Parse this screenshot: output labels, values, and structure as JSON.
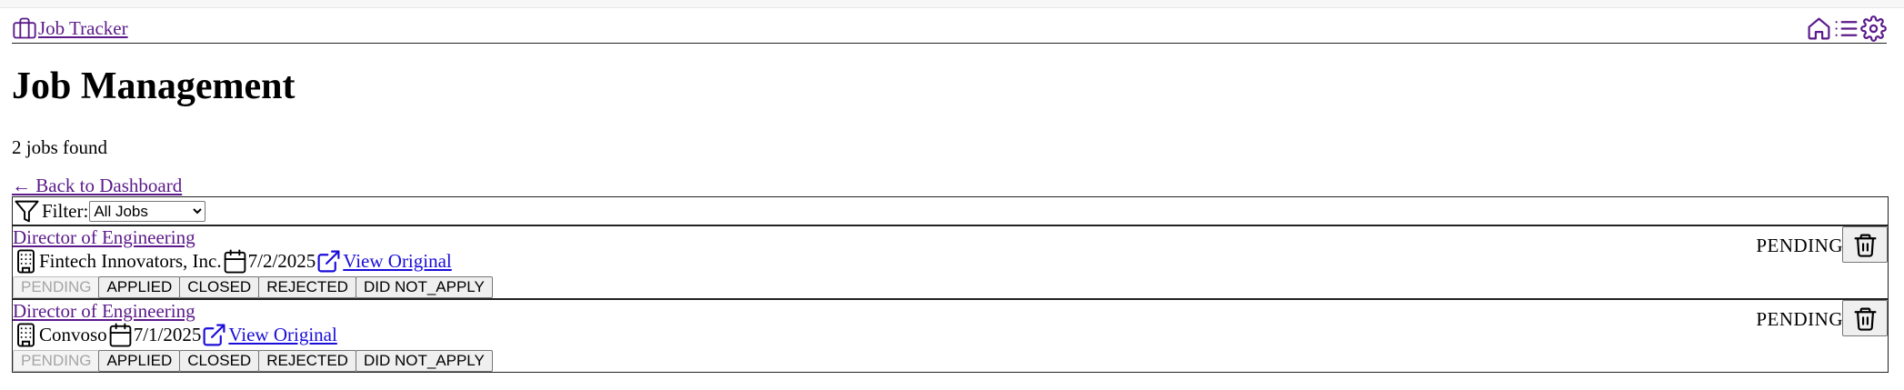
{
  "nav": {
    "brand_label": "Job Tracker",
    "brand_icon": "briefcase-icon",
    "icons": [
      "home-icon",
      "list-icon",
      "gear-icon"
    ],
    "accent_color": "#5b1a8a"
  },
  "page": {
    "title": "Job Management",
    "count_text": "2 jobs found",
    "back_link": "← Back to Dashboard"
  },
  "filter": {
    "label": "Filter:",
    "selected": "All Jobs"
  },
  "jobs": [
    {
      "title": "Director of Engineering",
      "company": "Fintech Innovators, Inc.",
      "date": "7/2/2025",
      "link_label": "View Original",
      "status": "PENDING",
      "status_buttons": [
        "PENDING",
        "APPLIED",
        "CLOSED",
        "REJECTED",
        "DID NOT_APPLY"
      ]
    },
    {
      "title": "Director of Engineering",
      "company": "Convoso",
      "date": "7/1/2025",
      "link_label": "View Original",
      "status": "PENDING",
      "status_buttons": [
        "PENDING",
        "APPLIED",
        "CLOSED",
        "REJECTED",
        "DID NOT_APPLY"
      ]
    }
  ]
}
